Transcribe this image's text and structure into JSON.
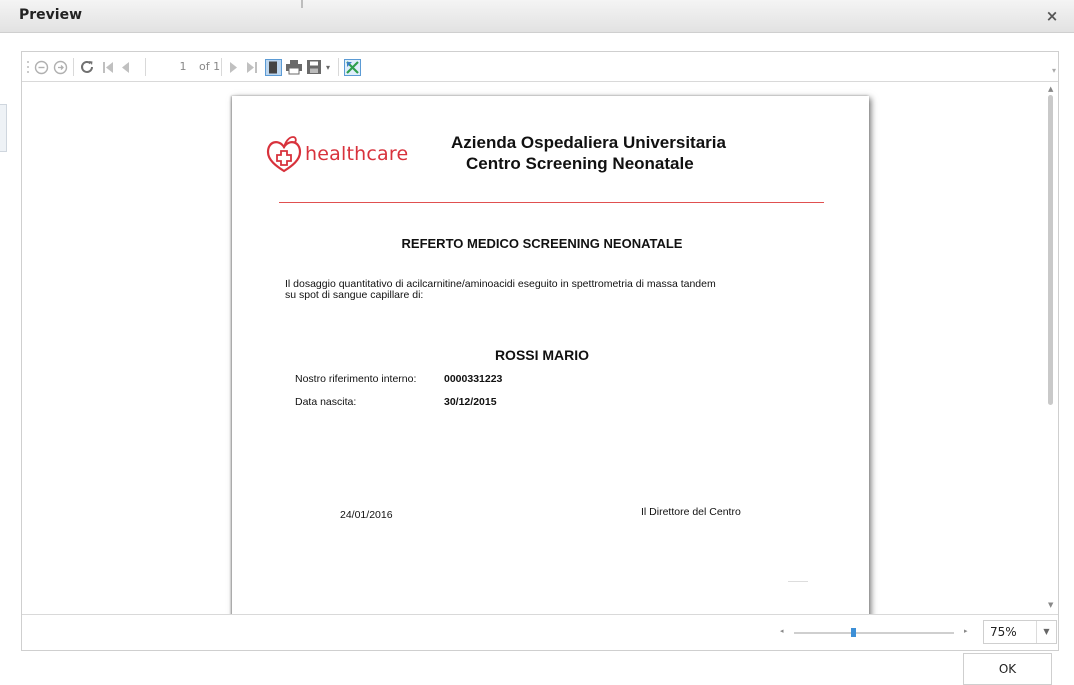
{
  "window": {
    "title": "Preview",
    "close_glyph": "×"
  },
  "toolbar": {
    "page_current": "1",
    "page_of": "of 1",
    "icons": [
      "zoom-out-icon",
      "zoom-in-icon",
      "refresh-icon",
      "first-page-icon",
      "previous-page-icon",
      "next-page-icon",
      "last-page-icon",
      "page-layout-icon",
      "print-icon",
      "save-icon",
      "export-excel-icon"
    ]
  },
  "document": {
    "logo_text_health": "health",
    "logo_text_care": "care",
    "org_line1": "Azienda Ospedaliera Universitaria",
    "org_line2": "Centro Screening Neonatale",
    "title": "REFERTO MEDICO SCREENING NEONATALE",
    "paragraph_line1": "Il dosaggio quantitativo di acilcarnitine/aminoacidi eseguito in spettrometria di massa tandem",
    "paragraph_line2": "su spot di sangue capillare di:",
    "patient_name": "ROSSI MARIO",
    "ref_label": "Nostro riferimento interno:",
    "ref_value": "0000331223",
    "birth_label": "Data nascita:",
    "birth_value": "30/12/2015",
    "date": "24/01/2016",
    "director": "Il Direttore del Centro",
    "colors": {
      "brand_red": "#d8323c",
      "rule_red": "#e05050"
    }
  },
  "zoom": {
    "value": "75%",
    "slider_level_percent": 37
  },
  "footer": {
    "ok_label": "OK"
  }
}
